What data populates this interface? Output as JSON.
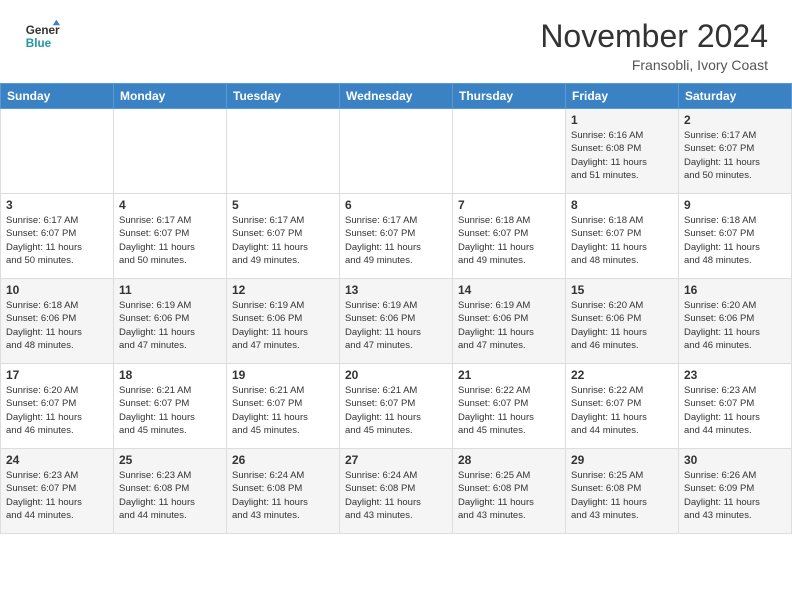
{
  "header": {
    "logo_line1": "General",
    "logo_line2": "Blue",
    "month": "November 2024",
    "location": "Fransobli, Ivory Coast"
  },
  "weekdays": [
    "Sunday",
    "Monday",
    "Tuesday",
    "Wednesday",
    "Thursday",
    "Friday",
    "Saturday"
  ],
  "weeks": [
    [
      {
        "day": "",
        "info": ""
      },
      {
        "day": "",
        "info": ""
      },
      {
        "day": "",
        "info": ""
      },
      {
        "day": "",
        "info": ""
      },
      {
        "day": "",
        "info": ""
      },
      {
        "day": "1",
        "info": "Sunrise: 6:16 AM\nSunset: 6:08 PM\nDaylight: 11 hours\nand 51 minutes."
      },
      {
        "day": "2",
        "info": "Sunrise: 6:17 AM\nSunset: 6:07 PM\nDaylight: 11 hours\nand 50 minutes."
      }
    ],
    [
      {
        "day": "3",
        "info": "Sunrise: 6:17 AM\nSunset: 6:07 PM\nDaylight: 11 hours\nand 50 minutes."
      },
      {
        "day": "4",
        "info": "Sunrise: 6:17 AM\nSunset: 6:07 PM\nDaylight: 11 hours\nand 50 minutes."
      },
      {
        "day": "5",
        "info": "Sunrise: 6:17 AM\nSunset: 6:07 PM\nDaylight: 11 hours\nand 49 minutes."
      },
      {
        "day": "6",
        "info": "Sunrise: 6:17 AM\nSunset: 6:07 PM\nDaylight: 11 hours\nand 49 minutes."
      },
      {
        "day": "7",
        "info": "Sunrise: 6:18 AM\nSunset: 6:07 PM\nDaylight: 11 hours\nand 49 minutes."
      },
      {
        "day": "8",
        "info": "Sunrise: 6:18 AM\nSunset: 6:07 PM\nDaylight: 11 hours\nand 48 minutes."
      },
      {
        "day": "9",
        "info": "Sunrise: 6:18 AM\nSunset: 6:07 PM\nDaylight: 11 hours\nand 48 minutes."
      }
    ],
    [
      {
        "day": "10",
        "info": "Sunrise: 6:18 AM\nSunset: 6:06 PM\nDaylight: 11 hours\nand 48 minutes."
      },
      {
        "day": "11",
        "info": "Sunrise: 6:19 AM\nSunset: 6:06 PM\nDaylight: 11 hours\nand 47 minutes."
      },
      {
        "day": "12",
        "info": "Sunrise: 6:19 AM\nSunset: 6:06 PM\nDaylight: 11 hours\nand 47 minutes."
      },
      {
        "day": "13",
        "info": "Sunrise: 6:19 AM\nSunset: 6:06 PM\nDaylight: 11 hours\nand 47 minutes."
      },
      {
        "day": "14",
        "info": "Sunrise: 6:19 AM\nSunset: 6:06 PM\nDaylight: 11 hours\nand 47 minutes."
      },
      {
        "day": "15",
        "info": "Sunrise: 6:20 AM\nSunset: 6:06 PM\nDaylight: 11 hours\nand 46 minutes."
      },
      {
        "day": "16",
        "info": "Sunrise: 6:20 AM\nSunset: 6:06 PM\nDaylight: 11 hours\nand 46 minutes."
      }
    ],
    [
      {
        "day": "17",
        "info": "Sunrise: 6:20 AM\nSunset: 6:07 PM\nDaylight: 11 hours\nand 46 minutes."
      },
      {
        "day": "18",
        "info": "Sunrise: 6:21 AM\nSunset: 6:07 PM\nDaylight: 11 hours\nand 45 minutes."
      },
      {
        "day": "19",
        "info": "Sunrise: 6:21 AM\nSunset: 6:07 PM\nDaylight: 11 hours\nand 45 minutes."
      },
      {
        "day": "20",
        "info": "Sunrise: 6:21 AM\nSunset: 6:07 PM\nDaylight: 11 hours\nand 45 minutes."
      },
      {
        "day": "21",
        "info": "Sunrise: 6:22 AM\nSunset: 6:07 PM\nDaylight: 11 hours\nand 45 minutes."
      },
      {
        "day": "22",
        "info": "Sunrise: 6:22 AM\nSunset: 6:07 PM\nDaylight: 11 hours\nand 44 minutes."
      },
      {
        "day": "23",
        "info": "Sunrise: 6:23 AM\nSunset: 6:07 PM\nDaylight: 11 hours\nand 44 minutes."
      }
    ],
    [
      {
        "day": "24",
        "info": "Sunrise: 6:23 AM\nSunset: 6:07 PM\nDaylight: 11 hours\nand 44 minutes."
      },
      {
        "day": "25",
        "info": "Sunrise: 6:23 AM\nSunset: 6:08 PM\nDaylight: 11 hours\nand 44 minutes."
      },
      {
        "day": "26",
        "info": "Sunrise: 6:24 AM\nSunset: 6:08 PM\nDaylight: 11 hours\nand 43 minutes."
      },
      {
        "day": "27",
        "info": "Sunrise: 6:24 AM\nSunset: 6:08 PM\nDaylight: 11 hours\nand 43 minutes."
      },
      {
        "day": "28",
        "info": "Sunrise: 6:25 AM\nSunset: 6:08 PM\nDaylight: 11 hours\nand 43 minutes."
      },
      {
        "day": "29",
        "info": "Sunrise: 6:25 AM\nSunset: 6:08 PM\nDaylight: 11 hours\nand 43 minutes."
      },
      {
        "day": "30",
        "info": "Sunrise: 6:26 AM\nSunset: 6:09 PM\nDaylight: 11 hours\nand 43 minutes."
      }
    ]
  ]
}
